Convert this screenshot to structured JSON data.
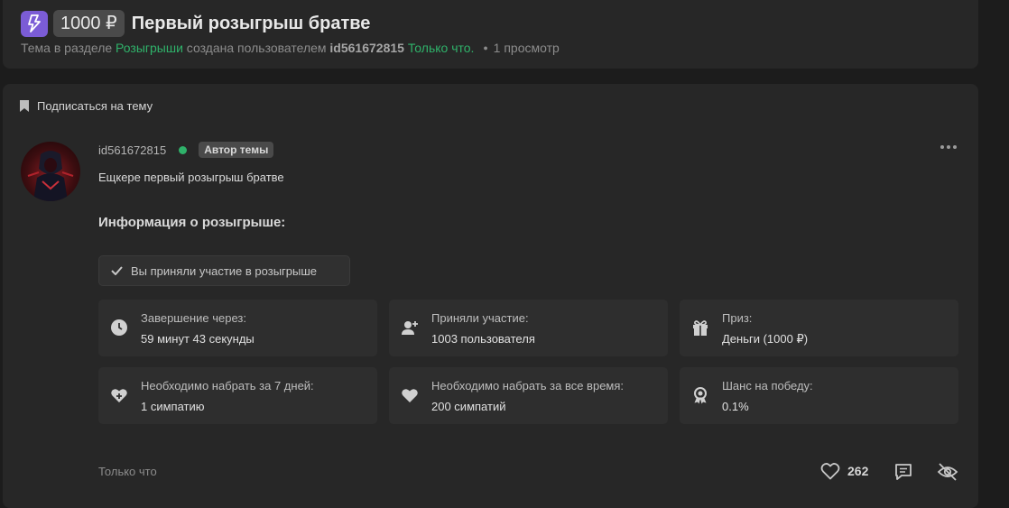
{
  "thread": {
    "price_badge": "1000 ₽",
    "title": "Первый розыгрыш братве",
    "meta": {
      "prefix": "Тема в разделе",
      "section": "Розыгрыши",
      "created_by": "создана пользователем",
      "author": "id561672815",
      "time": "Только что.",
      "views": "1 просмотр"
    }
  },
  "subscribe_label": "Подписаться на тему",
  "post": {
    "author": "id561672815",
    "author_badge": "Автор темы",
    "text": "Ещкере первый розыгрыш братве",
    "info_heading": "Информация о розыгрыше:",
    "joined_label": "Вы приняли участие в розыгрыше",
    "tiles": [
      {
        "icon": "clock-icon",
        "label": "Завершение через:",
        "value": "59 минут 43 секунды"
      },
      {
        "icon": "user-plus-icon",
        "label": "Приняли участие:",
        "value": "1003 пользователя"
      },
      {
        "icon": "gift-icon",
        "label": "Приз:",
        "value": "Деньги (1000 ₽)"
      },
      {
        "icon": "heart-plus-icon",
        "label": "Необходимо набрать за 7 дней:",
        "value": "1 симпатию"
      },
      {
        "icon": "heart-icon",
        "label": "Необходимо набрать за все время:",
        "value": "200 симпатий"
      },
      {
        "icon": "award-icon",
        "label": "Шанс на победу:",
        "value": "0.1%"
      }
    ],
    "footer_time": "Только что",
    "likes": "262"
  },
  "colors": {
    "accent_green": "#2fb26a",
    "bolt_badge": "#7b5cd6",
    "card_bg": "#272727",
    "page_bg": "#1c1c1c"
  }
}
